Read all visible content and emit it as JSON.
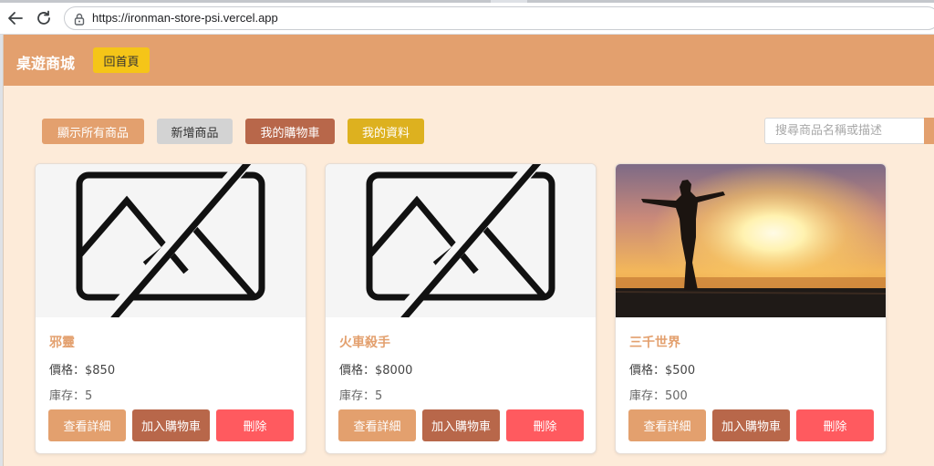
{
  "browser": {
    "url": "https://ironman-store-psi.vercel.app"
  },
  "header": {
    "brand": "桌遊商城",
    "home_label": "回首頁"
  },
  "toolbar": {
    "show_all_label": "顯示所有商品",
    "add_product_label": "新增商品",
    "my_cart_label": "我的購物車",
    "my_profile_label": "我的資料"
  },
  "search": {
    "placeholder": "搜尋商品名稱或描述"
  },
  "products": [
    {
      "name": "邪靈",
      "price": "價格：$850",
      "stock": "庫存：5",
      "image": "placeholder-image-icon"
    },
    {
      "name": "火車殺手",
      "price": "價格：$8000",
      "stock": "庫存：5",
      "image": "placeholder-image-icon"
    },
    {
      "name": "三千世界",
      "price": "價格：$500",
      "stock": "庫存：500",
      "image": "sunset-silhouette-photo"
    }
  ],
  "card_actions": {
    "detail_label": "查看詳細",
    "add_cart_label": "加入購物車",
    "delete_label": "刪除"
  },
  "colors": {
    "header_bg": "#e3a06e",
    "page_bg": "#fdebd9",
    "home_button": "#f5c518",
    "cart_button": "#b8674a",
    "delete_button": "#ff5a5f",
    "profile_button": "#ddb11f"
  }
}
